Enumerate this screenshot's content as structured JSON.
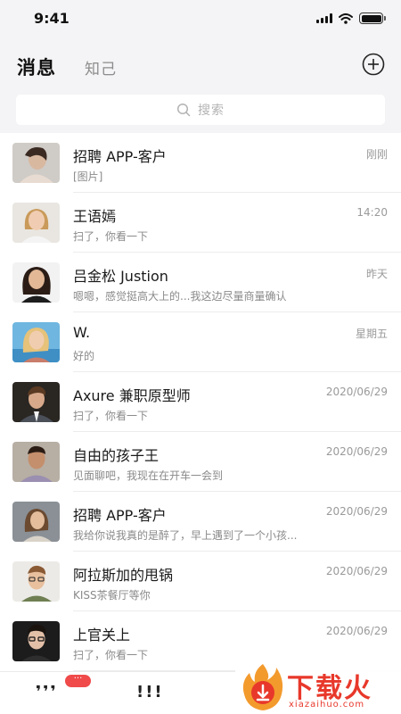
{
  "status_bar": {
    "time": "9:41"
  },
  "header": {
    "active_tab": "消息",
    "inactive_tab": "知己",
    "add_icon": "plus-circle-icon"
  },
  "search": {
    "placeholder": "搜索",
    "icon": "search-icon"
  },
  "conversations": [
    {
      "name": "招聘 APP-客户",
      "preview": "[图片]",
      "time": "刚刚"
    },
    {
      "name": "王语嫣",
      "preview": "扫了，你看一下",
      "time": "14:20"
    },
    {
      "name": "吕金松 Justion",
      "preview": "嗯嗯，感觉挺高大上的...我这边尽量商量确认",
      "time": "昨天"
    },
    {
      "name": "W.",
      "preview": "好的",
      "time": "星期五"
    },
    {
      "name": "Axure  兼职原型师",
      "preview": "扫了，你看一下",
      "time": "2020/06/29"
    },
    {
      "name": "自由的孩子王",
      "preview": "见面聊吧，我现在在开车一会到",
      "time": "2020/06/29"
    },
    {
      "name": "招聘 APP-客户",
      "preview": "我给你说我真的是醉了，早上遇到了一个小孩...",
      "time": "2020/06/29"
    },
    {
      "name": "阿拉斯加的甩锅",
      "preview": "KISS茶餐厅等你",
      "time": "2020/06/29"
    },
    {
      "name": "上官关上",
      "preview": "扫了，你看一下",
      "time": "2020/06/29"
    }
  ],
  "tab_bar": {
    "tab1_icon": "❜❜❜",
    "tab1_badge": "···",
    "tab2_icon": "!!!"
  },
  "watermark": {
    "text": "下载火",
    "sub": "xiazaihuo.com"
  },
  "colors": {
    "accent_badge": "#f04a4a",
    "header_bg": "#f4f4f6",
    "watermark": "#e8382b"
  }
}
